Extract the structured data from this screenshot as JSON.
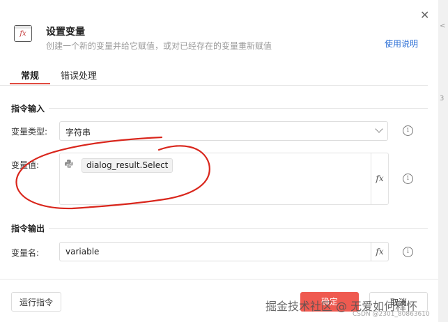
{
  "dialog": {
    "title": "设置变量",
    "subtitle": "创建一个新的变量并给它赋值，或对已经存在的变量重新赋值",
    "help_link": "使用说明",
    "close_symbol": "✕",
    "icon_text": "fx"
  },
  "tabs": [
    {
      "label": "常规",
      "active": true
    },
    {
      "label": "错误处理",
      "active": false
    }
  ],
  "inputs_section": {
    "heading": "指令输入",
    "type_label": "变量类型:",
    "type_value": "字符串",
    "value_label": "变量值:",
    "value_chip": "dialog_result.Select",
    "fx_label": "fx"
  },
  "outputs_section": {
    "heading": "指令输出",
    "name_label": "变量名:",
    "name_value": "variable",
    "fx_label": "fx"
  },
  "footer": {
    "run_button": "运行指令",
    "ok_button": "确定",
    "cancel_button": "取消"
  },
  "watermark": {
    "main": "掘金技术社区 @ 无爱如何释怀",
    "sub": "CSDN @2301_80863610"
  },
  "info_symbol": "i",
  "right_strip": [
    "<",
    "3"
  ],
  "colors": {
    "accent_red": "#ef5a50",
    "tab_underline": "#e04a3f",
    "link_blue": "#2c6fd6",
    "annotation_red": "#d9261c"
  }
}
